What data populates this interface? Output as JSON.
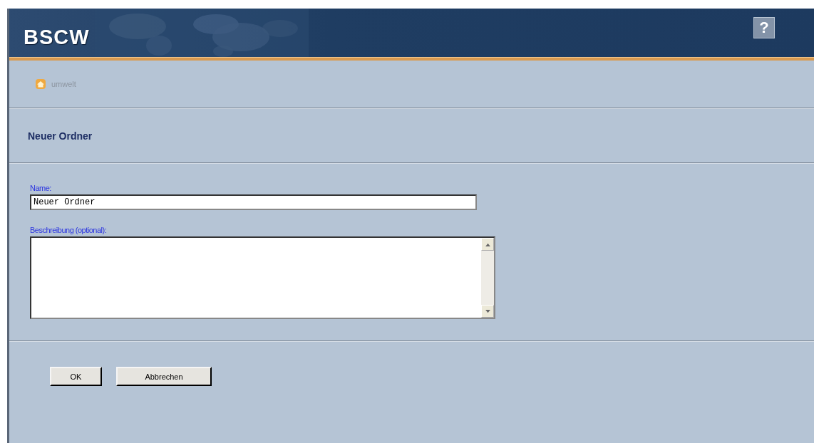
{
  "header": {
    "logo": "BSCW",
    "help": "?"
  },
  "breadcrumb": {
    "label": "umwelt"
  },
  "title": "Neuer Ordner",
  "form": {
    "name_label": "Name:",
    "name_value": "Neuer Ordner",
    "description_label": "Beschreibung (optional):"
  },
  "buttons": [
    "OK",
    "Abbrechen"
  ]
}
